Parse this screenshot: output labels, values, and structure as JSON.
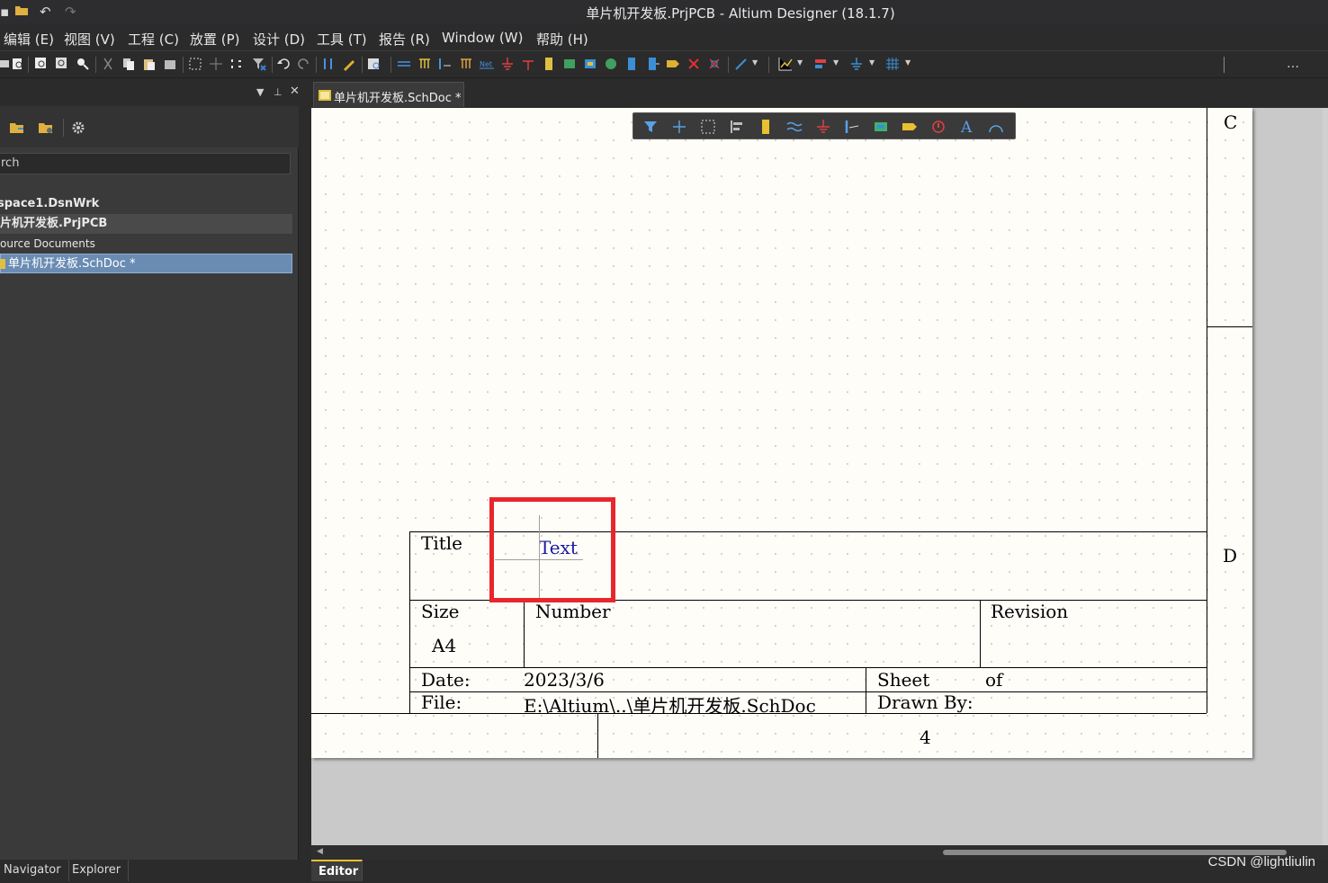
{
  "window": {
    "title": "单片机开发板.PrjPCB - Altium Designer (18.1.7)"
  },
  "menu": [
    "编辑 (E)",
    "视图 (V)",
    "工程 (C)",
    "放置 (P)",
    "设计 (D)",
    "工具 (T)",
    "报告 (R)",
    "Window (W)",
    "帮助 (H)"
  ],
  "left_panel": {
    "search_placeholder": "rch",
    "tree": {
      "workspace": "space1.DsnWrk",
      "project": "片机开发板.PrjPCB",
      "folder": "ource Documents",
      "document": "单片机开发板.SchDoc *"
    },
    "bottom_tabs": [
      "Navigator",
      "Explorer"
    ]
  },
  "document_tab": {
    "label": "单片机开发板.SchDoc *"
  },
  "editor_tab": "Editor",
  "sheet": {
    "zone_c": "C",
    "zone_d": "D",
    "zone_4": "4",
    "title_block": {
      "title_label": "Title",
      "title_value": "Text",
      "size_label": "Size",
      "size_value": "A4",
      "number_label": "Number",
      "revision_label": "Revision",
      "date_label": "Date:",
      "date_value": "2023/3/6",
      "sheet_label": "Sheet",
      "of_label": "of",
      "file_label": "File:",
      "file_value": "E:\\Altium\\..\\单片机开发板.SchDoc",
      "drawn_by_label": "Drawn By:"
    }
  },
  "colors": {
    "highlight": "#e8262c",
    "title_text": "#1a1aa0",
    "selection": "#6a8cb3"
  },
  "watermark": "CSDN @lightliulin"
}
